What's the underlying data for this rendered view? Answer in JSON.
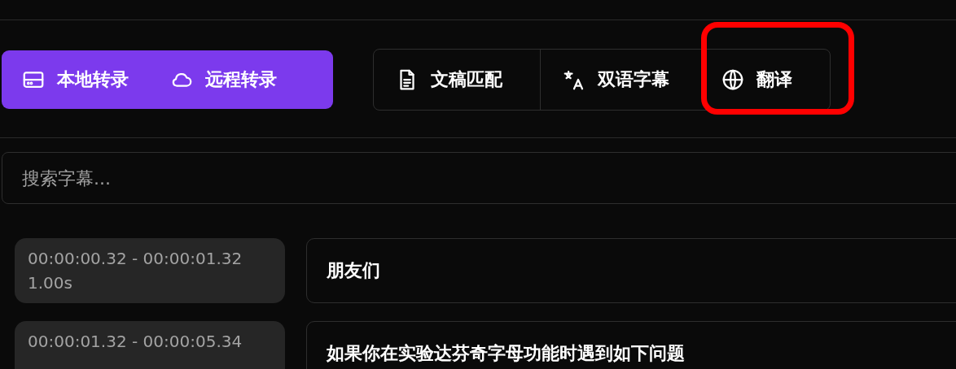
{
  "transcribe_modes": [
    {
      "label": "本地转录"
    },
    {
      "label": "远程转录"
    }
  ],
  "tools": [
    {
      "label": "文稿匹配",
      "highlighted": false
    },
    {
      "label": "双语字幕",
      "highlighted": false
    },
    {
      "label": "翻译",
      "highlighted": true
    }
  ],
  "search": {
    "placeholder": "搜索字幕..."
  },
  "subtitles": [
    {
      "time": "00:00:00.32 - 00:00:01.32",
      "duration": "1.00s",
      "text": "朋友们"
    },
    {
      "time": "00:00:01.32 - 00:00:05.34",
      "text": "如果你在实验达芬奇字母功能时遇到如下问题"
    }
  ]
}
